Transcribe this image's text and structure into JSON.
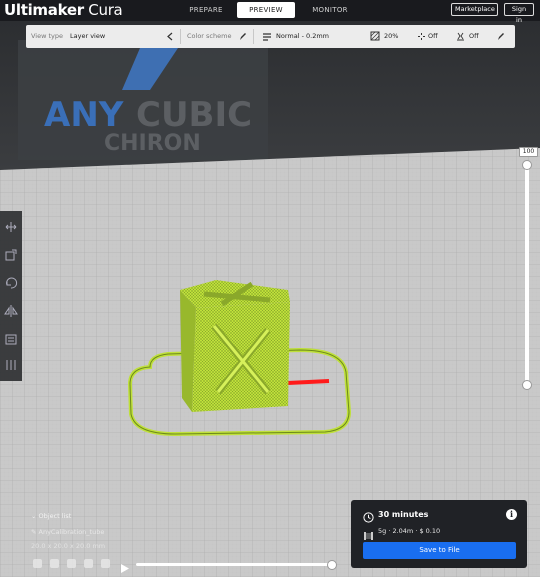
{
  "app": {
    "title_bold": "Ultimaker",
    "title_light": " Cura"
  },
  "stages": [
    {
      "label": "PREPARE",
      "active": false
    },
    {
      "label": "PREVIEW",
      "active": true
    },
    {
      "label": "MONITOR",
      "active": false
    }
  ],
  "header": {
    "marketplace_label": "Marketplace",
    "sign_in_label": "Sign in"
  },
  "view_toolbar": {
    "view_type_label": "View type",
    "view_type_value": "Layer view",
    "color_scheme_label": "Color scheme",
    "profile_value": "Normal - 0.2mm",
    "infill_value": "20%",
    "support_value": "Off",
    "adhesion_value": "Off"
  },
  "printer_branding": {
    "brand_part1": "ANY",
    "brand_part2": "CUBIC",
    "model": "CHIRON"
  },
  "layer_slider": {
    "value": "100"
  },
  "object_info": {
    "list_label": "Object list",
    "object_name": "AnyCalibration_tube",
    "dimensions": "20.0 x 20.0 x 20.0 mm"
  },
  "print_info": {
    "time": "30 minutes",
    "material": "5g · 2.04m · $ 0.10",
    "save_label": "Save to File"
  },
  "colors": {
    "accent_blue": "#196ef0",
    "model_green": "#bfe03a",
    "header_dark": "#191a1e",
    "travel_red": "#ff1a1a"
  },
  "icons": {
    "view_type_chevron": "chevron-left-icon",
    "color_scheme": "pencil-icon",
    "profile": "sliders-icon",
    "infill": "infill-icon",
    "support": "support-icon",
    "adhesion": "adhesion-icon",
    "settings": "pencil-icon",
    "time": "clock-icon",
    "material": "spool-icon",
    "info": "info-icon"
  }
}
